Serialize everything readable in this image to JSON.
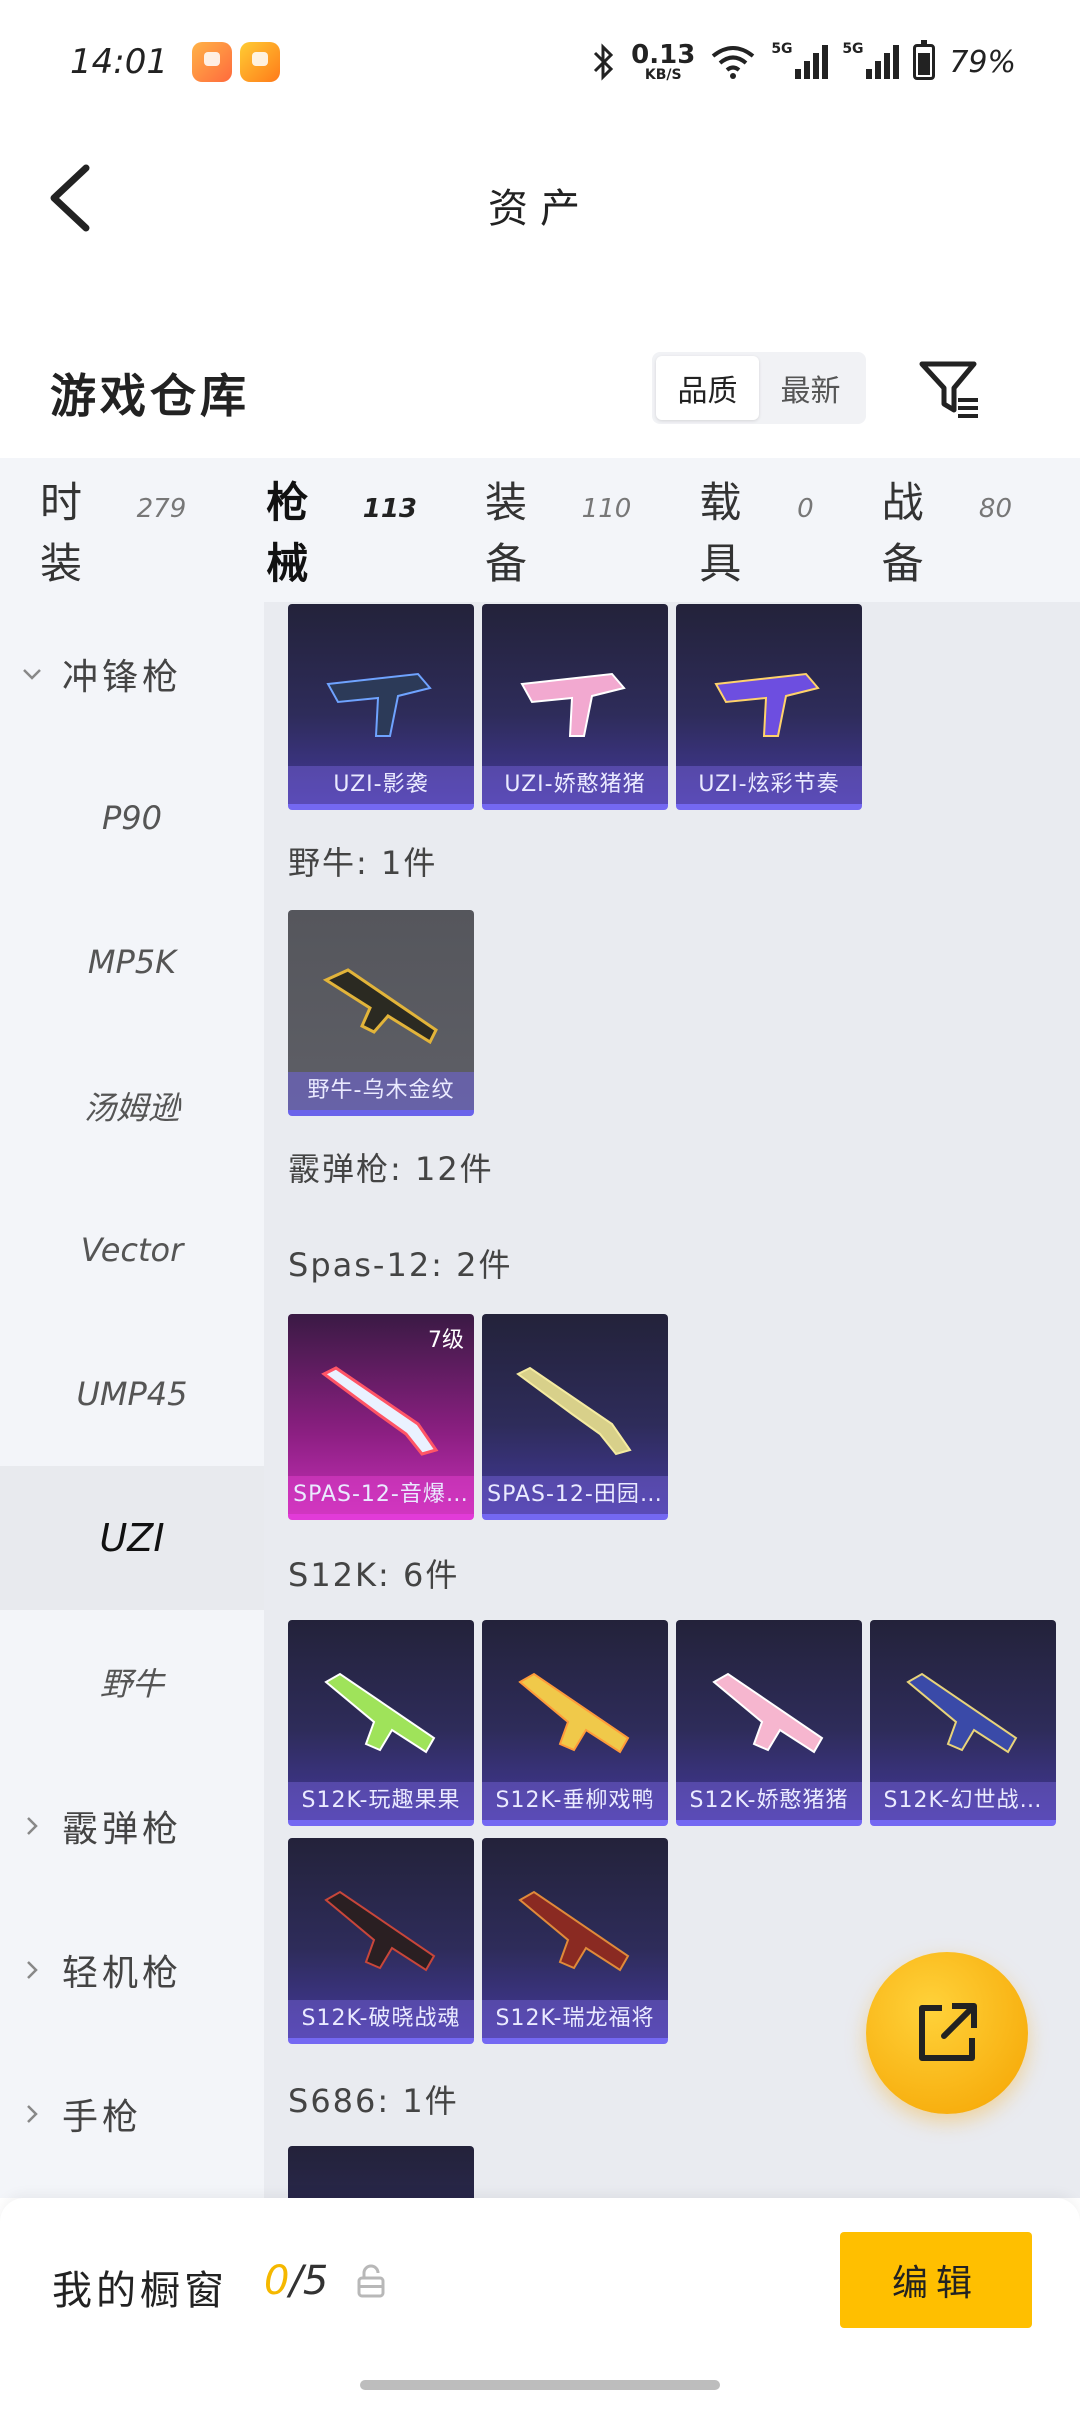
{
  "status_bar": {
    "time": "14:01",
    "net_speed_value": "0.13",
    "net_speed_unit": "KB/S",
    "signal1_label": "5G",
    "signal2_label": "5G",
    "battery_percent": "79%",
    "icons": [
      "bluetooth-icon",
      "wifi-icon",
      "signal-icon",
      "battery-icon"
    ]
  },
  "header": {
    "title": "资产"
  },
  "warehouse": {
    "title": "游戏仓库",
    "sort_options": [
      "品质",
      "最新"
    ],
    "active_sort": "品质"
  },
  "category_tabs": [
    {
      "label": "时装",
      "count": "279"
    },
    {
      "label": "枪械",
      "count": "113"
    },
    {
      "label": "装备",
      "count": "110"
    },
    {
      "label": "载具",
      "count": "0"
    },
    {
      "label": "战备",
      "count": "80"
    }
  ],
  "active_tab": "枪械",
  "sidebar": {
    "items": [
      {
        "label": "冲锋枪",
        "type": "group",
        "expanded": true
      },
      {
        "label": "P90",
        "type": "item"
      },
      {
        "label": "MP5K",
        "type": "item"
      },
      {
        "label": "汤姆逊",
        "type": "item"
      },
      {
        "label": "Vector",
        "type": "item"
      },
      {
        "label": "UMP45",
        "type": "item"
      },
      {
        "label": "UZI",
        "type": "item",
        "active": true
      },
      {
        "label": "野牛",
        "type": "item"
      },
      {
        "label": "霰弹枪",
        "type": "group",
        "expanded": false
      },
      {
        "label": "轻机枪",
        "type": "group",
        "expanded": false
      },
      {
        "label": "手枪",
        "type": "group",
        "expanded": false
      }
    ]
  },
  "content": {
    "uzi_cards": [
      {
        "name": "UZI-影袭"
      },
      {
        "name": "UZI-娇憨猪猪"
      },
      {
        "name": "UZI-炫彩节奏"
      }
    ],
    "bison_section": "野牛: 1件",
    "bison_cards": [
      {
        "name": "野牛-乌木金纹"
      }
    ],
    "shotgun_section": "霰弹枪: 12件",
    "spas_section": "Spas-12: 2件",
    "spas_cards": [
      {
        "name": "SPAS-12-音爆…",
        "level": "7级"
      },
      {
        "name": "SPAS-12-田园…"
      }
    ],
    "s12k_section": "S12K: 6件",
    "s12k_cards": [
      {
        "name": "S12K-玩趣果果"
      },
      {
        "name": "S12K-垂柳戏鸭"
      },
      {
        "name": "S12K-娇憨猪猪"
      },
      {
        "name": "S12K-幻世战…"
      },
      {
        "name": "S12K-破晓战魂"
      },
      {
        "name": "S12K-瑞龙福将"
      }
    ],
    "s686_section": "S686: 1件"
  },
  "bottom": {
    "showcase_title": "我的橱窗",
    "showcase_current": "0",
    "showcase_total": "/5",
    "edit_label": "编辑"
  },
  "colors": {
    "accent": "#ffbf00",
    "card_bottom": "#7468f2",
    "pink_card": "#c42fb6"
  }
}
